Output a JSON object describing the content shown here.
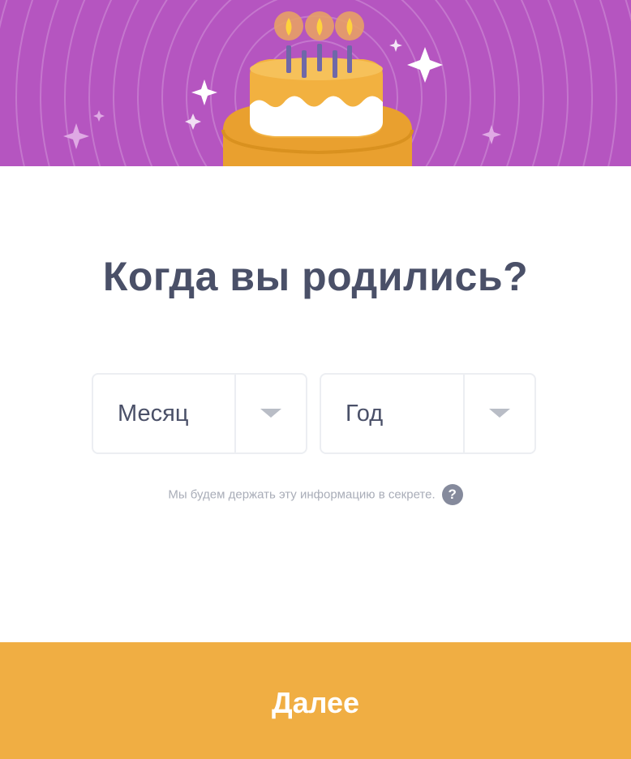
{
  "header": {
    "illustration": "birthday-cake-illustration",
    "background_color": "#b555c0"
  },
  "title": "Когда вы родились?",
  "month_select": {
    "value": "Месяц",
    "icon": "chevron-down-icon"
  },
  "year_select": {
    "value": "Год",
    "icon": "chevron-down-icon"
  },
  "privacy_note": {
    "text": "Мы будем держать эту информацию в секрете.",
    "help_icon_glyph": "?"
  },
  "next_button": {
    "label": "Далее",
    "color": "#f0ae43"
  }
}
